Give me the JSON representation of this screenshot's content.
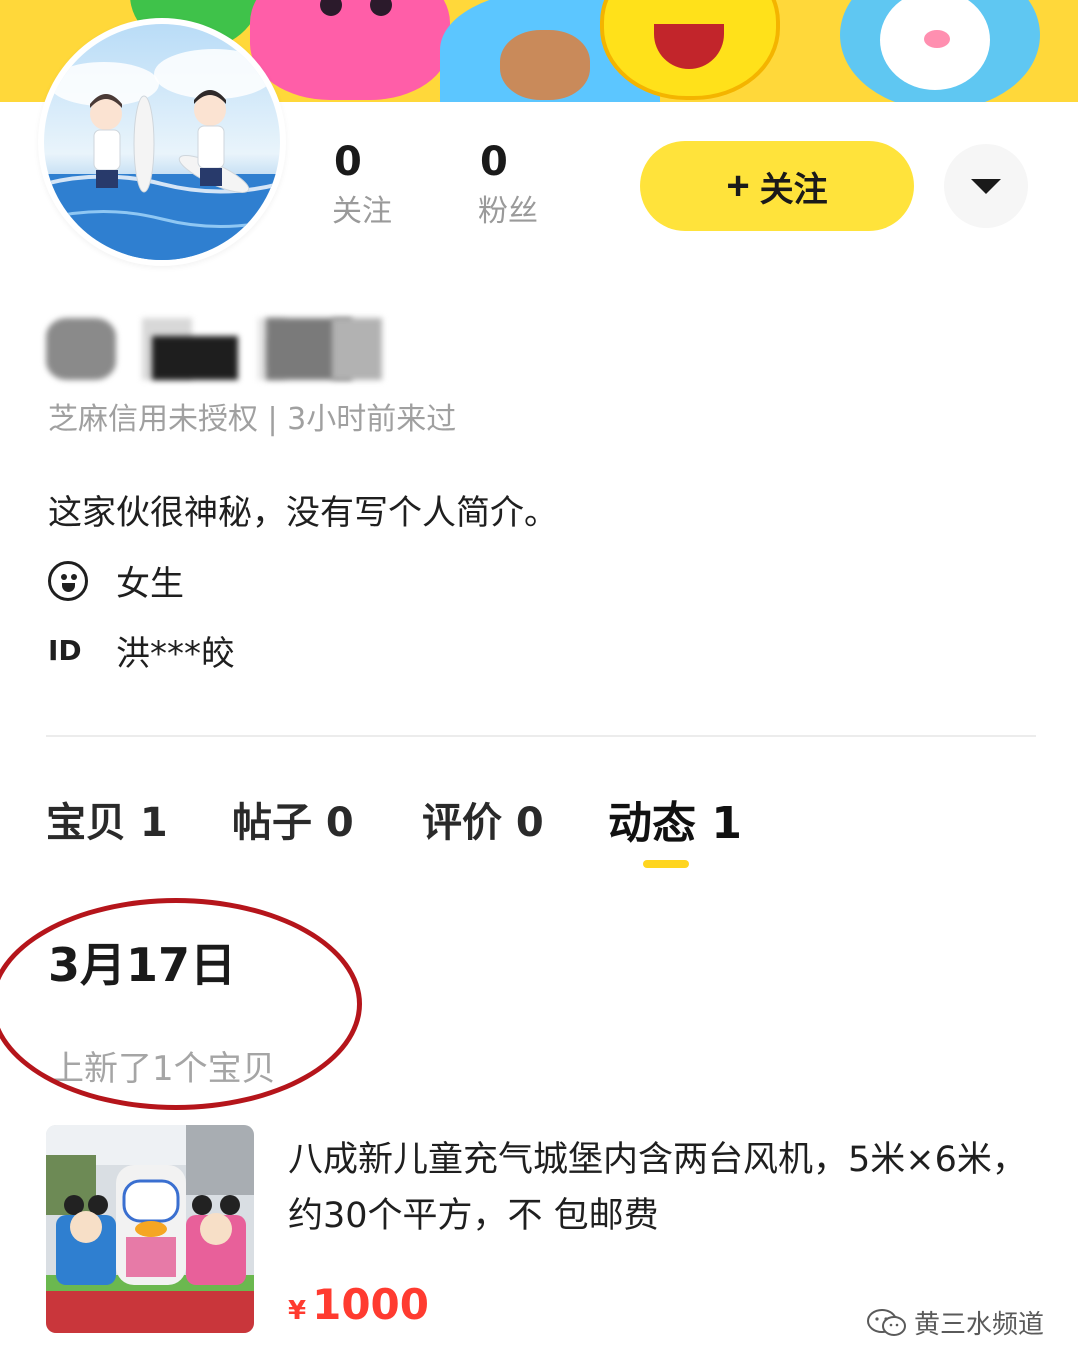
{
  "profile": {
    "stats": {
      "following_count": "0",
      "following_label": "关注",
      "fans_count": "0",
      "fans_label": "粉丝"
    },
    "follow_button": {
      "plus": "+",
      "label": "关注"
    },
    "credit_line": "芝麻信用未授权 | 3小时前来过",
    "bio": "这家伙很神秘，没有写个人简介。",
    "gender": "女生",
    "id_label": "ID",
    "id_value": "洪***皎"
  },
  "tabs": [
    {
      "label": "宝贝 1",
      "active": false
    },
    {
      "label": "帖子 0",
      "active": false
    },
    {
      "label": "评价 0",
      "active": false
    },
    {
      "label": "动态 1",
      "active": true
    }
  ],
  "feed": {
    "date": "3月17日",
    "summary": "上新了1个宝贝",
    "item": {
      "title": "八成新儿童充气城堡内含两台风机，5米×6米，约30个平方，不 包邮费",
      "currency": "¥",
      "price": "1000"
    }
  },
  "watermark": {
    "text": "黄三水频道"
  },
  "colors": {
    "accent_yellow": "#ffe33b",
    "price_red": "#ff3b30",
    "annotation_circle": "#b5151b"
  }
}
